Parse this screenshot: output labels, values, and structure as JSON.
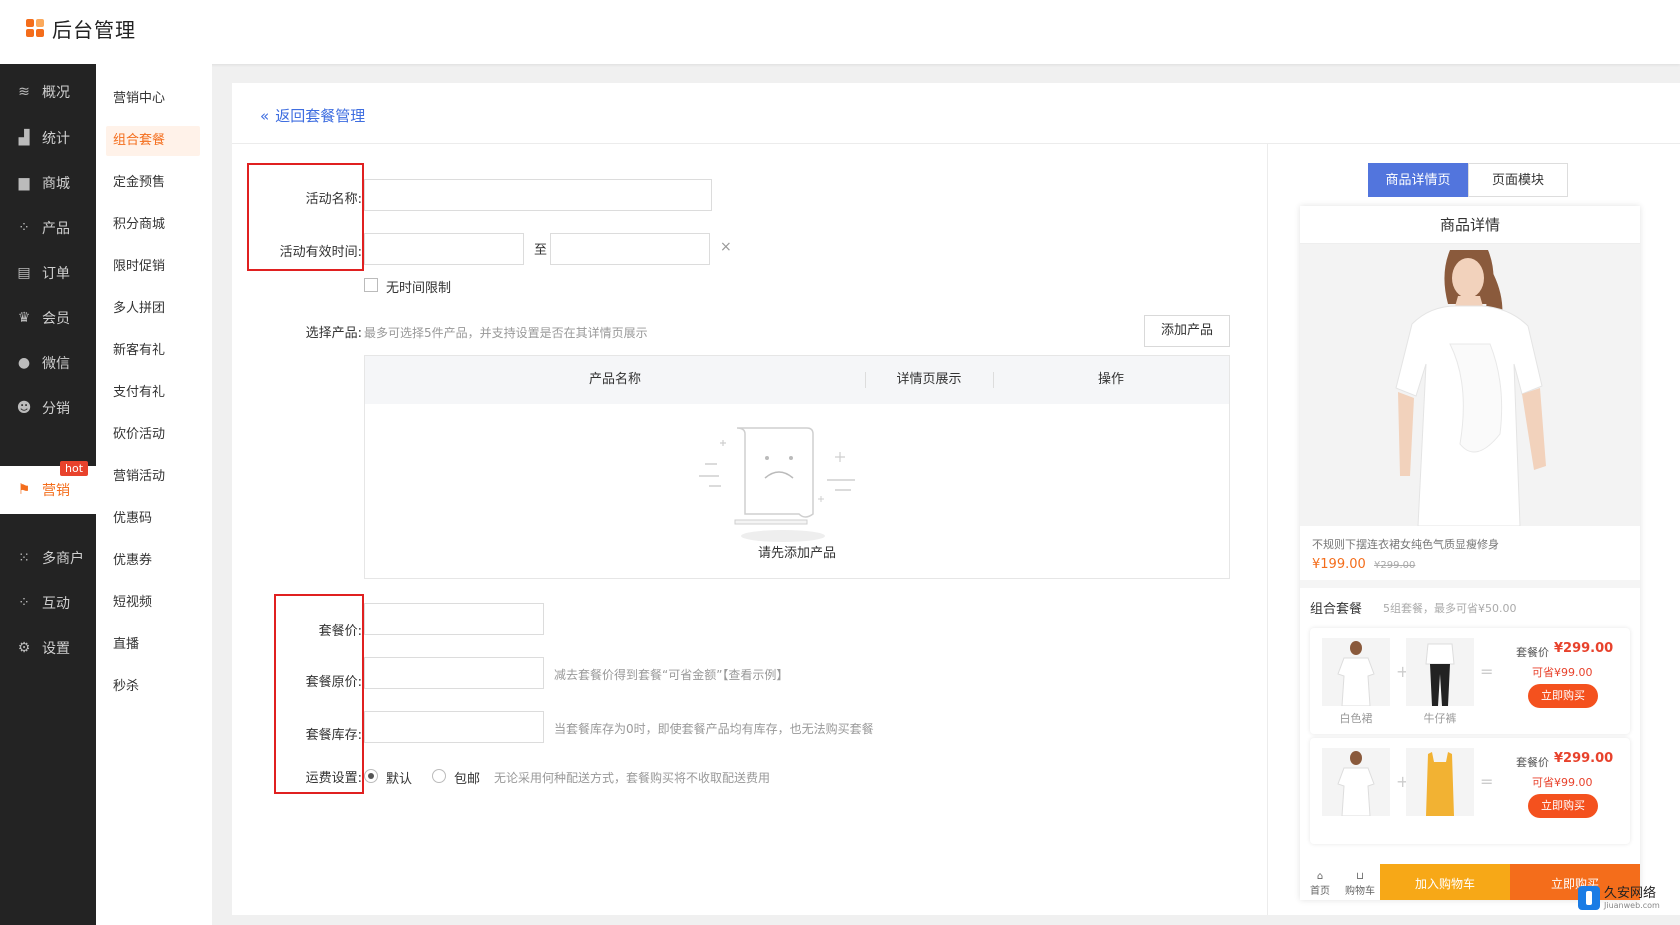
{
  "app": {
    "title": "后台管理"
  },
  "sidebar_primary": [
    {
      "label": "概况",
      "icon": "layers-icon"
    },
    {
      "label": "统计",
      "icon": "chart-icon"
    },
    {
      "label": "商城",
      "icon": "store-icon"
    },
    {
      "label": "产品",
      "icon": "grid-icon"
    },
    {
      "label": "订单",
      "icon": "order-icon"
    },
    {
      "label": "会员",
      "icon": "crown-icon"
    },
    {
      "label": "微信",
      "icon": "wechat-icon"
    },
    {
      "label": "分销",
      "icon": "user-icon"
    },
    {
      "label": "营销",
      "icon": "flag-icon",
      "badge": "hot"
    },
    {
      "label": "多商户",
      "icon": "merchant-icon"
    },
    {
      "label": "互动",
      "icon": "interact-icon"
    },
    {
      "label": "设置",
      "icon": "gear-icon"
    }
  ],
  "sidebar_secondary": [
    "营销中心",
    "组合套餐",
    "定金预售",
    "积分商城",
    "限时促销",
    "多人拼团",
    "新客有礼",
    "支付有礼",
    "砍价活动",
    "营销活动",
    "优惠码",
    "优惠券",
    "短视频",
    "直播",
    "秒杀"
  ],
  "back_link": "返回套餐管理",
  "form": {
    "name_label": "活动名称:",
    "time_label": "活动有效时间:",
    "time_sep": "至",
    "clear": "×",
    "no_limit": "无时间限制",
    "product_label": "选择产品:",
    "product_hint": "最多可选择5件产品，并支持设置是否在其详情页展示",
    "add_product": "添加产品",
    "table_headers": [
      "产品名称",
      "详情页展示",
      "操作"
    ],
    "empty_text": "请先添加产品",
    "price_label": "套餐价:",
    "orig_label": "套餐原价:",
    "orig_hint": "减去套餐价得到套餐“可省金额”【查看示例】",
    "stock_label": "套餐库存:",
    "stock_hint": "当套餐库存为0时，即使套餐产品均有库存，也无法购买套餐",
    "ship_label": "运费设置:",
    "ship_default": "默认",
    "ship_free": "包邮",
    "ship_hint": "无论采用何种配送方式，套餐购买将不收取配送费用"
  },
  "preview": {
    "tabs": [
      "商品详情页",
      "页面模块"
    ],
    "title": "商品详情",
    "product_name": "不规则下摆连衣裙女纯色气质显瘦修身",
    "price": "¥199.00",
    "old_price": "¥299.00",
    "combo_title": "组合套餐",
    "combo_sub": "5组套餐，最多可省¥50.00",
    "cards": [
      {
        "items": [
          "白色裙",
          "牛仔裤"
        ],
        "label": "套餐价",
        "price": "¥299.00",
        "save": "可省¥99.00",
        "buy": "立即购买"
      },
      {
        "items": [
          "",
          ""
        ],
        "label": "套餐价",
        "price": "¥299.00",
        "save": "可省¥99.00",
        "buy": "立即购买"
      }
    ],
    "bottom": {
      "home": "首页",
      "cart_icon": "购物车",
      "add_cart": "加入购物车",
      "buy_now": "立即购买"
    }
  },
  "watermark": {
    "name": "久安网络",
    "domain": "Jiuanweb.com"
  }
}
